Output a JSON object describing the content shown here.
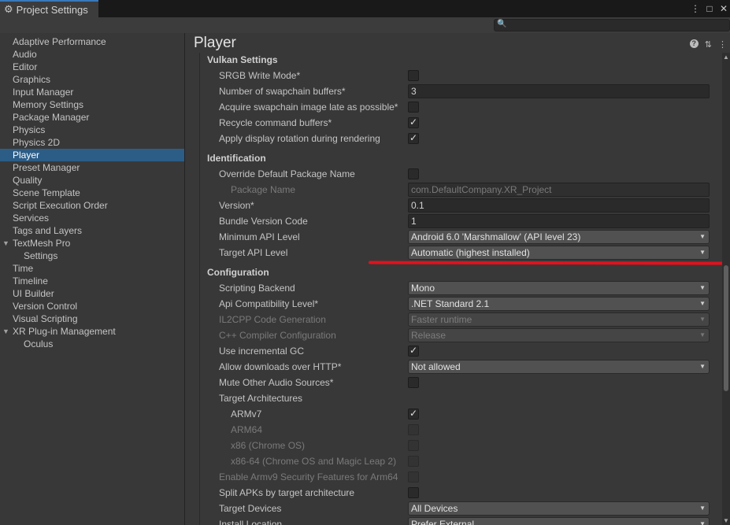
{
  "window": {
    "tab_title": "Project Settings",
    "controls": [
      "⋮",
      "□",
      "✕"
    ]
  },
  "search": {
    "placeholder": ""
  },
  "sidebar": {
    "items": [
      {
        "label": "Adaptive Performance"
      },
      {
        "label": "Audio"
      },
      {
        "label": "Editor"
      },
      {
        "label": "Graphics"
      },
      {
        "label": "Input Manager"
      },
      {
        "label": "Memory Settings"
      },
      {
        "label": "Package Manager"
      },
      {
        "label": "Physics"
      },
      {
        "label": "Physics 2D"
      },
      {
        "label": "Player"
      },
      {
        "label": "Preset Manager"
      },
      {
        "label": "Quality"
      },
      {
        "label": "Scene Template"
      },
      {
        "label": "Script Execution Order"
      },
      {
        "label": "Services"
      },
      {
        "label": "Tags and Layers"
      },
      {
        "label": "TextMesh Pro"
      },
      {
        "label": "Settings"
      },
      {
        "label": "Time"
      },
      {
        "label": "Timeline"
      },
      {
        "label": "UI Builder"
      },
      {
        "label": "Version Control"
      },
      {
        "label": "Visual Scripting"
      },
      {
        "label": "XR Plug-in Management"
      },
      {
        "label": "Oculus"
      }
    ],
    "selected": "Player"
  },
  "main": {
    "title": "Player",
    "vulkan": {
      "heading": "Vulkan Settings",
      "srgb_label": "SRGB Write Mode*",
      "swapchain_label": "Number of swapchain buffers*",
      "swapchain_value": "3",
      "acquire_label": "Acquire swapchain image late as possible*",
      "recycle_label": "Recycle command buffers*",
      "rotation_label": "Apply display rotation during rendering"
    },
    "identification": {
      "heading": "Identification",
      "override_label": "Override Default Package Name",
      "package_label": "Package Name",
      "package_value": "com.DefaultCompany.XR_Project",
      "version_label": "Version*",
      "version_value": "0.1",
      "bundle_label": "Bundle Version Code",
      "bundle_value": "1",
      "min_api_label": "Minimum API Level",
      "min_api_value": "Android 6.0 'Marshmallow' (API level 23)",
      "target_api_label": "Target API Level",
      "target_api_value": "Automatic (highest installed)"
    },
    "configuration": {
      "heading": "Configuration",
      "backend_label": "Scripting Backend",
      "backend_value": "Mono",
      "api_compat_label": "Api Compatibility Level*",
      "api_compat_value": ".NET Standard 2.1",
      "il2cpp_label": "IL2CPP Code Generation",
      "il2cpp_value": "Faster runtime",
      "cpp_label": "C++ Compiler Configuration",
      "cpp_value": "Release",
      "gc_label": "Use incremental GC",
      "http_label": "Allow downloads over HTTP*",
      "http_value": "Not allowed",
      "mute_label": "Mute Other Audio Sources*",
      "arch_label": "Target Architectures",
      "armv7_label": "ARMv7",
      "arm64_label": "ARM64",
      "x86_label": "x86 (Chrome OS)",
      "x8664_label": "x86-64 (Chrome OS and Magic Leap 2)",
      "armv9_label": "Enable Armv9 Security Features for Arm64",
      "split_label": "Split APKs by target architecture",
      "devices_label": "Target Devices",
      "devices_value": "All Devices",
      "install_label": "Install Location",
      "install_value": "Prefer External"
    }
  },
  "colors": {
    "accent_selection": "#2c5d87",
    "annotation_line": "#e0121e"
  }
}
